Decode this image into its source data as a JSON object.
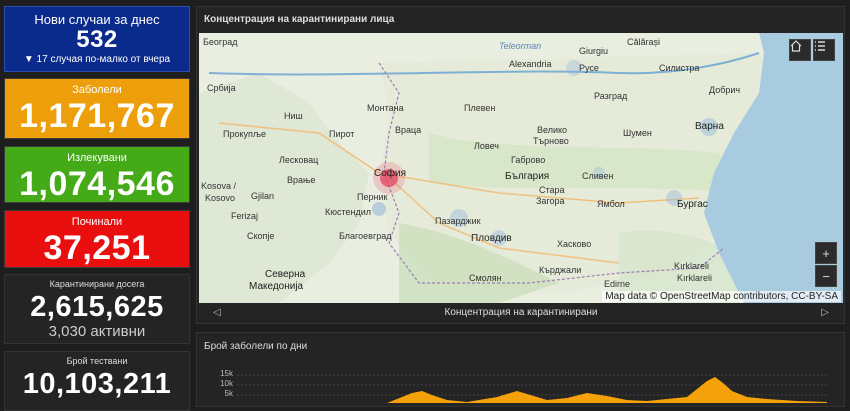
{
  "cards": {
    "new_cases": {
      "label": "Нови случаи за днес",
      "value": "532",
      "change_arrow": "▼",
      "change_text": "17 случая по-малко от вчера"
    },
    "infected": {
      "label": "Заболели",
      "value": "1,171,767"
    },
    "recovered": {
      "label": "Излекувани",
      "value": "1,074,546"
    },
    "deceased": {
      "label": "Починали",
      "value": "37,251"
    },
    "quarantined": {
      "label": "Карантинирани досега",
      "value": "2,615,625",
      "active": "3,030 активни"
    },
    "tests": {
      "label": "Брой тествани",
      "value": "10,103,211"
    }
  },
  "map_panel": {
    "title": "Концентрация на карантинирани лица",
    "attribution": "Map data © OpenStreetMap contributors, CC-BY-SA",
    "nav_label": "Концентрация на карантинирани",
    "home_icon": "home-icon",
    "list_icon": "list-icon",
    "zoom_in": "+",
    "zoom_out": "−",
    "prev_icon": "◁",
    "next_icon": "▷",
    "labels": {
      "belgrade": "Београд",
      "teleorman": "Teleorman",
      "giurgiu": "Giurgiu",
      "calarasi": "Călărași",
      "alexandria": "Alexandria",
      "ruse": "Русе",
      "silistra": "Силистра",
      "dobrich": "Добрич",
      "montana": "Монтана",
      "pleven": "Плевен",
      "razgrad": "Разград",
      "nis": "Ниш",
      "vratsa": "Враца",
      "shumen": "Шумен",
      "varna": "Варна",
      "prokuplje": "Прокупље",
      "pirot": "Пирот",
      "lovech": "Ловеч",
      "v_tarnovo_1": "Велико",
      "v_tarnovo_2": "Търново",
      "leskovac": "Лесковац",
      "gabrovo": "Габрово",
      "sofia": "София",
      "bulgaria": "България",
      "sliven": "Сливен",
      "stara": "Стара",
      "zagora": "Загора",
      "kosovo_1": "Kosova /",
      "kosovo_2": "Kosovo",
      "vranje": "Врање",
      "gjilan": "Gjilan",
      "pernik": "Перник",
      "yambol": "Ямбол",
      "burgas": "Бургас",
      "kyustendil": "Кюстендил",
      "ferizaj": "Ferizaj",
      "pazardzhik": "Пазарджик",
      "skopje": "Скопје",
      "blagoevgrad": "Благоевград",
      "plovdiv": "Пловдив",
      "haskovo": "Хасково",
      "kirklareli_1": "Kırklareli",
      "kirklareli_2": "Kırklareli",
      "severna_1": "Северна",
      "severna_2": "Македонија",
      "smolyan": "Смолян",
      "kardzhali": "Кърджали",
      "edirne": "Edirne",
      "srbija": "Србија"
    }
  },
  "chart_panel": {
    "title": "Брой заболели по дни",
    "y_ticks": [
      "15k",
      "10k",
      "5k"
    ],
    "series_color": "#f5a10a"
  },
  "colors": {
    "new_cases_bg": "#0a2a8c",
    "infected_bg": "#ec9f0a",
    "recovered_bg": "#44aa18",
    "deceased_bg": "#e90f0f",
    "panel_bg": "#242424",
    "page_bg": "#1e1e1e"
  }
}
